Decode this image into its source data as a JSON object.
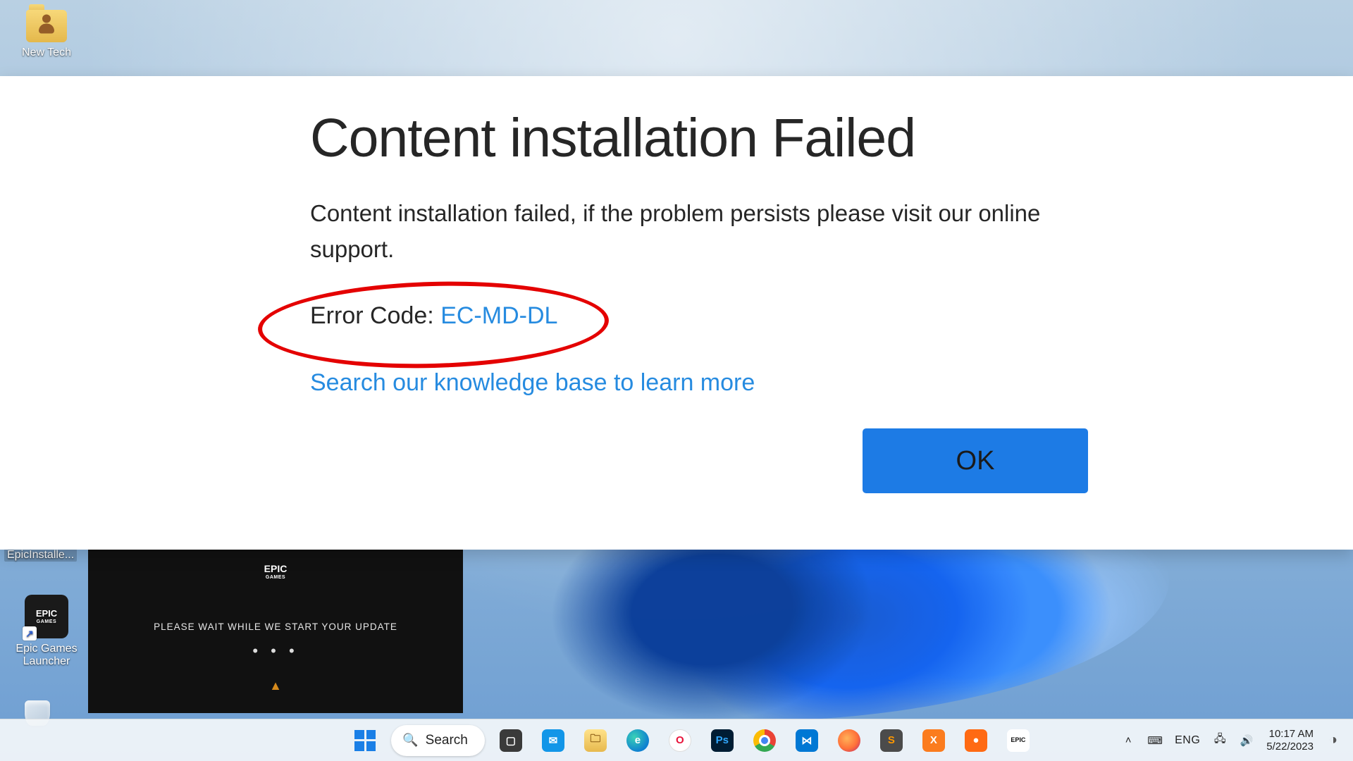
{
  "desktop": {
    "folder_label": "New Tech",
    "epic_installer_label": "EpicInstalle...",
    "epic_launcher_label": "Epic Games Launcher"
  },
  "modal": {
    "title": "Content installation Failed",
    "body": "Content installation failed, if the problem persists please visit our online support.",
    "error_code_label": "Error Code: ",
    "error_code": "EC-MD-DL",
    "kb_link": "Search our knowledge base to learn more",
    "ok_label": "OK"
  },
  "epic_window": {
    "logo_top": "EPIC",
    "logo_sub": "GAMES",
    "message": "PLEASE WAIT WHILE WE START YOUR UPDATE",
    "dots": "• • •",
    "warn": "▲"
  },
  "taskbar": {
    "search_label": "Search",
    "lang": "ENG",
    "time": "10:17 AM",
    "date": "5/22/2023"
  },
  "colors": {
    "accent": "#1d7be5",
    "link": "#268be0",
    "annotation": "#e40000"
  }
}
